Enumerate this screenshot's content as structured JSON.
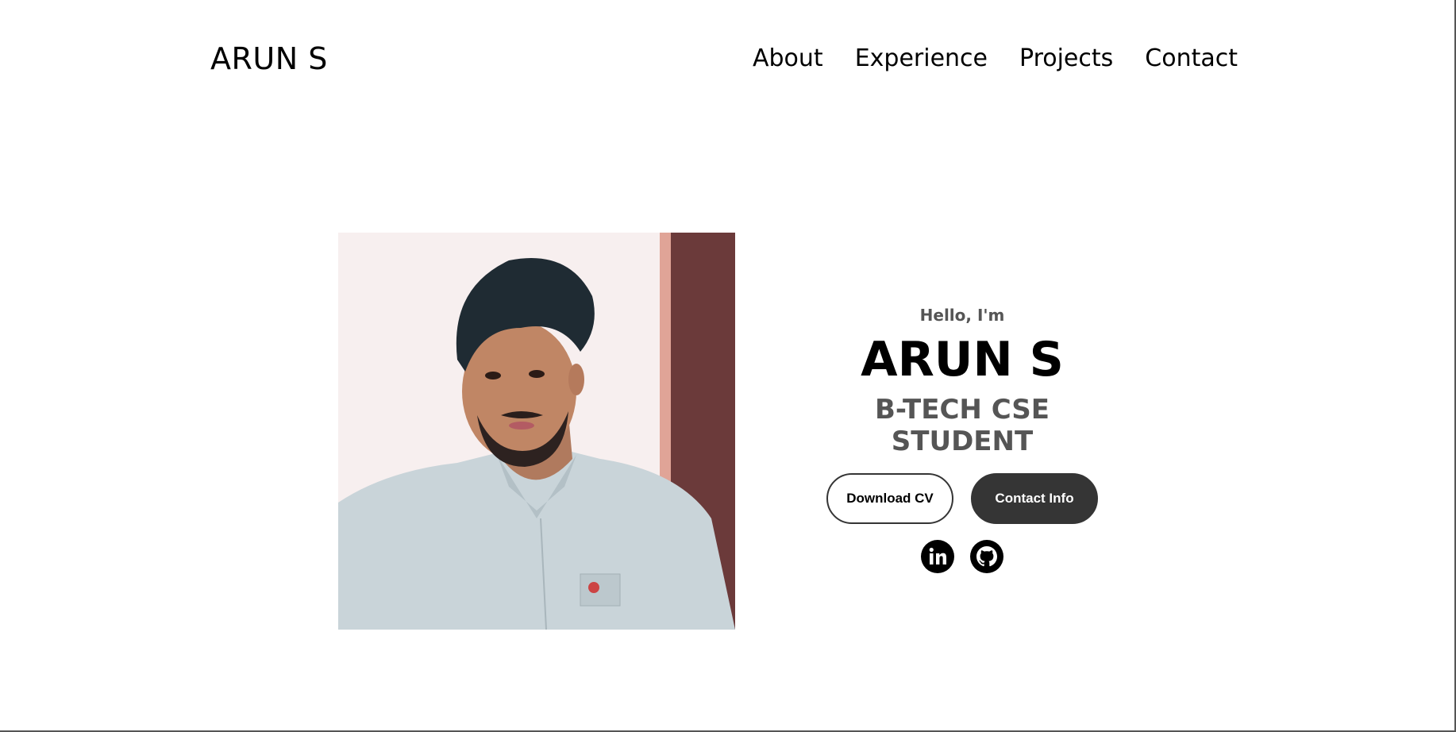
{
  "header": {
    "logo": "ARUN S",
    "nav": [
      "About",
      "Experience",
      "Projects",
      "Contact"
    ]
  },
  "hero": {
    "greeting": "Hello, I'm",
    "name": "ARUN S",
    "role": "B-TECH CSE STUDENT",
    "buttons": {
      "download_cv": "Download CV",
      "contact_info": "Contact Info"
    },
    "socials": [
      "linkedin-icon",
      "github-icon"
    ],
    "photo": "profile-photo"
  },
  "colors": {
    "text": "#000000",
    "muted": "#555555",
    "button_dark": "#353535",
    "background": "#ffffff"
  }
}
